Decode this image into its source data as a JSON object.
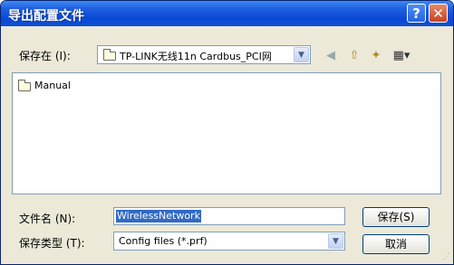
{
  "window": {
    "title": "导出配置文件"
  },
  "save_in": {
    "label": "保存在 (I):",
    "value": "TP-LINK无线11n Cardbus_PCI网"
  },
  "toolbar": {
    "back_icon": "back-arrow",
    "up_icon": "up-folder",
    "new_folder_icon": "new-folder",
    "view_icon": "view-menu"
  },
  "files": [
    {
      "name": "Manual",
      "type": "folder"
    }
  ],
  "filename": {
    "label": "文件名 (N):",
    "value": "WirelessNetwork"
  },
  "filetype": {
    "label": "保存类型 (T):",
    "value": "Config files (*.prf)"
  },
  "buttons": {
    "save": "保存(S)",
    "cancel": "取消"
  },
  "colors": {
    "title_bar": "#0a49d6",
    "dialog_bg": "#ece9d8",
    "selection": "#316ac5"
  }
}
